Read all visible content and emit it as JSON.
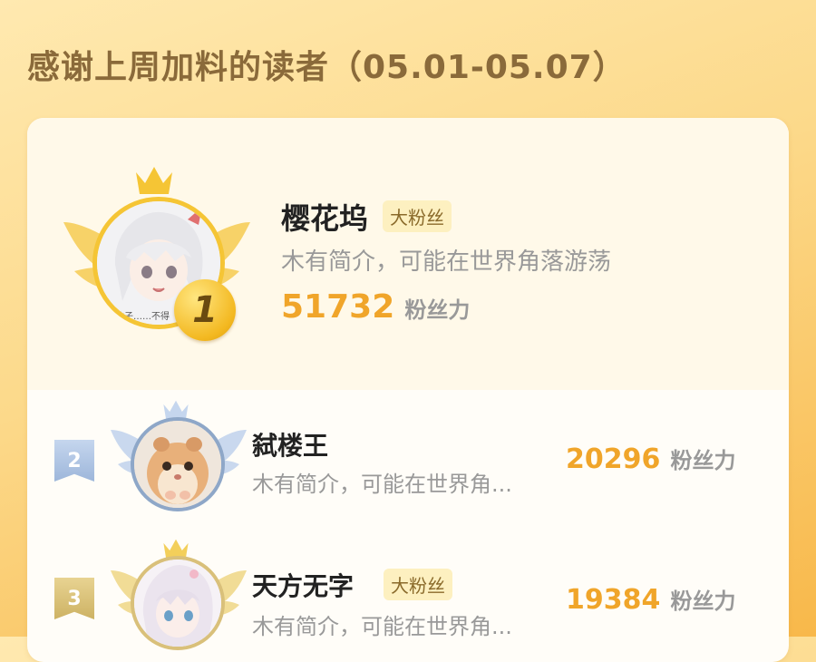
{
  "header": {
    "title": "感谢上周加料的读者（05.01-05.07）"
  },
  "readers": [
    {
      "rank": "1",
      "name": "樱花坞",
      "tag": "大粉丝",
      "bio": "木有简介，可能在世界角落游荡",
      "score": "51732",
      "unit": "粉丝力",
      "avatar_caption": "伙子……不得"
    },
    {
      "rank": "2",
      "name": "弑楼王",
      "tag": "",
      "bio": "木有简介，可能在世界角...",
      "score": "20296",
      "unit": "粉丝力"
    },
    {
      "rank": "3",
      "name": "天方无字",
      "tag": "大粉丝",
      "bio": "木有简介，可能在世界角...",
      "score": "19384",
      "unit": "粉丝力"
    }
  ],
  "colors": {
    "accent": "#f0a52a",
    "gold": "#f3b820",
    "silver": "#a9bfdc",
    "bronze": "#d9c07a"
  }
}
